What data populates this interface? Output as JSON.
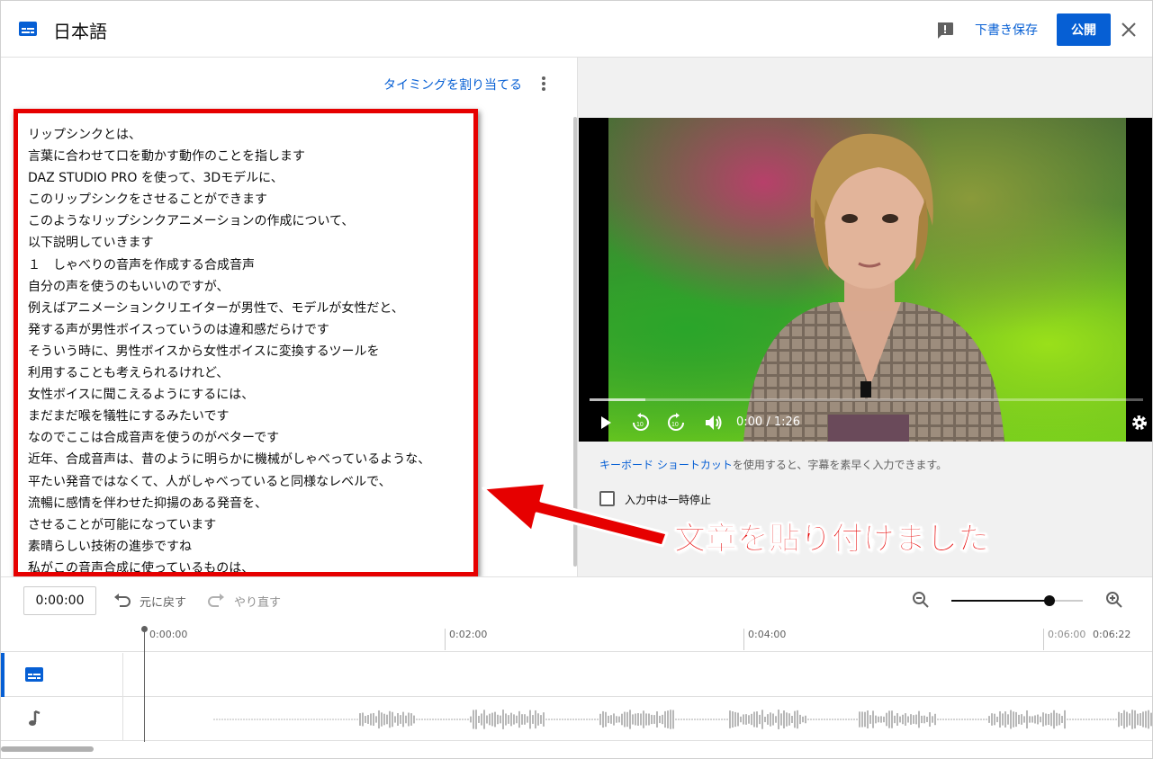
{
  "header": {
    "title": "日本語",
    "save_draft_label": "下書き保存",
    "publish_label": "公開",
    "icons": [
      "subtitles-icon",
      "feedback-icon",
      "close-icon"
    ]
  },
  "editor": {
    "assign_timing_label": "タイミングを割り当てる",
    "lines": [
      "リップシンクとは、",
      "言葉に合わせて口を動かす動作のことを指します",
      "DAZ STUDIO PRO を使って、3Dモデルに、",
      "このリップシンクをさせることができます",
      "このようなリップシンクアニメーションの作成について、",
      "以下説明していきます",
      "１　しゃべりの音声を作成する合成音声",
      "自分の声を使うのもいいのですが、",
      "例えばアニメーションクリエイターが男性で、モデルが女性だと、",
      "発する声が男性ボイスっていうのは違和感だらけです",
      "そういう時に、男性ボイスから女性ボイスに変換するツールを",
      "利用することも考えられるけれど、",
      "女性ボイスに聞こえるようにするには、",
      "まだまだ喉を犠牲にするみたいです",
      "なのでここは合成音声を使うのがベターです",
      "近年、合成音声は、昔のように明らかに機械がしゃべっているような、",
      "平たい発音ではなくて、人がしゃべっていると同様なレベルで、",
      "流暢に感情を伴わせた抑揚のある発音を、",
      "させることが可能になっています",
      "素晴らしい技術の進歩ですね",
      "私がこの音声合成に使っているものは、"
    ]
  },
  "player": {
    "time": "0:00 / 1:26",
    "buffered_fraction": 0.1,
    "icons": [
      "play-icon",
      "replay-10-icon",
      "forward-10-icon",
      "volume-icon",
      "settings-icon"
    ]
  },
  "hint": {
    "link": "キーボード ショートカット",
    "rest": "を使用すると、字幕を素早く入力できます。"
  },
  "pause_while_typing": {
    "label": "入力中は一時停止",
    "checked": false
  },
  "annotation": {
    "text": "文章を貼り付けました",
    "color": "#e60000"
  },
  "timeline": {
    "current_time": "0:00:00",
    "undo_label": "元に戻す",
    "redo_label": "やり直す",
    "zoom_level": 0.8,
    "ticks": [
      "0:00:00",
      "0:02:00",
      "0:04:00",
      "0:06:00"
    ],
    "total": "0:06:22"
  },
  "colors": {
    "accent": "#065fd4",
    "annotation_red": "#e60000"
  }
}
